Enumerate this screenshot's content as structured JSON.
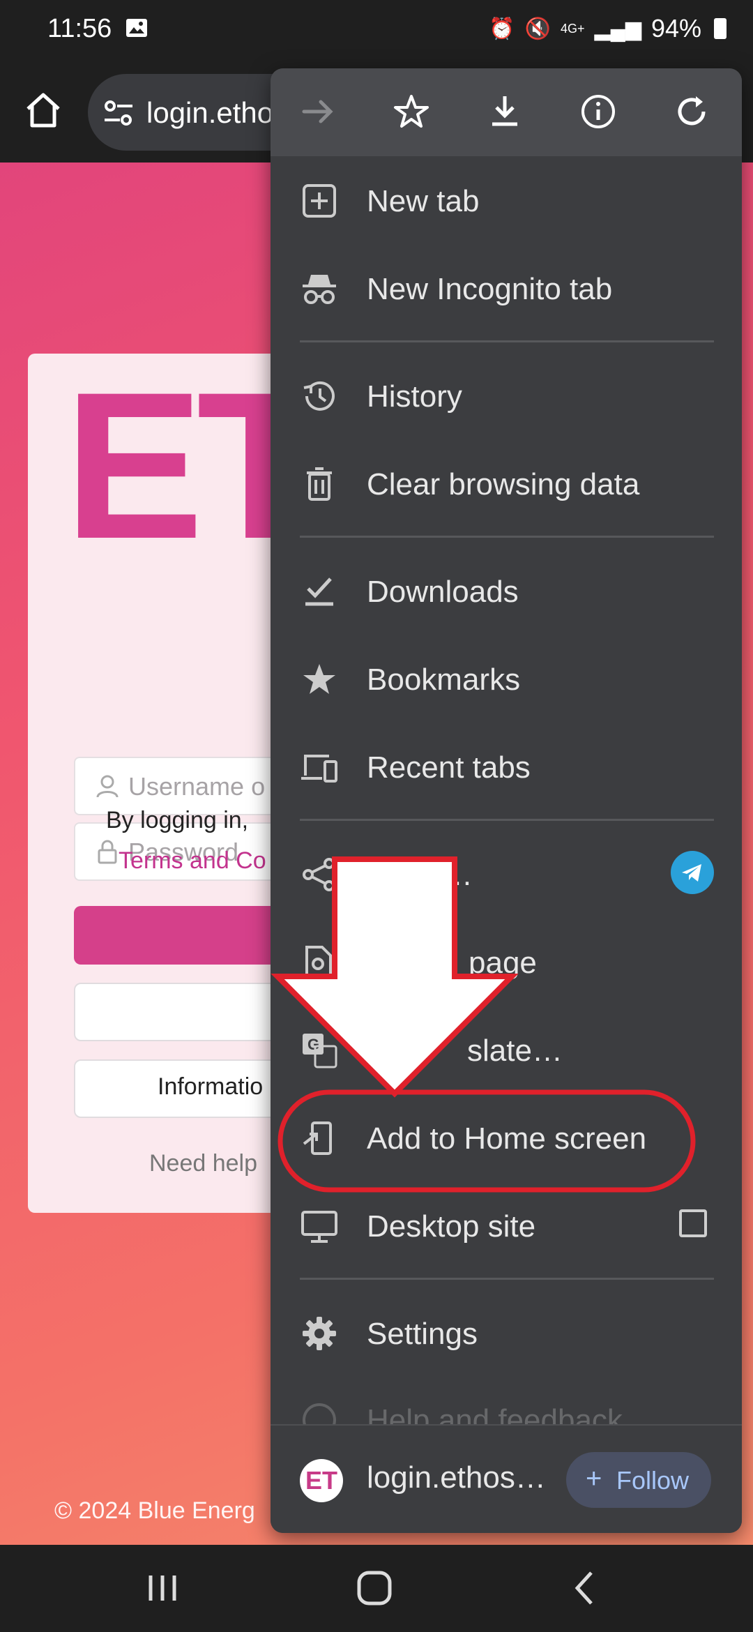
{
  "status_bar": {
    "time": "11:56",
    "network": "4G+",
    "battery": "94%"
  },
  "browser": {
    "url": "login.ethos"
  },
  "page": {
    "logo": "ET",
    "username_placeholder": "Username o",
    "password_placeholder": "Password",
    "consent_text": "By logging in,",
    "terms_link": "Terms and Co",
    "info_button": "Informatio",
    "need_help": "Need help",
    "copyright": "© 2024 Blue Energ"
  },
  "menu": {
    "top_icons": [
      "forward-arrow-icon",
      "star-icon",
      "download-icon",
      "info-icon",
      "refresh-icon"
    ],
    "items": [
      {
        "label": "New tab",
        "icon": "new-tab-icon"
      },
      {
        "label": "New Incognito tab",
        "icon": "incognito-icon"
      },
      {
        "label": "History",
        "icon": "history-icon"
      },
      {
        "label": "Clear browsing data",
        "icon": "trash-icon"
      },
      {
        "label": "Downloads",
        "icon": "downloads-check-icon"
      },
      {
        "label": "Bookmarks",
        "icon": "star-icon"
      },
      {
        "label": "Recent tabs",
        "icon": "devices-icon"
      },
      {
        "label": "…",
        "icon": "share-icon"
      },
      {
        "label": "page",
        "icon": "find-in-page-icon"
      },
      {
        "label": "slate…",
        "icon": "translate-icon"
      },
      {
        "label": "Add to Home screen",
        "icon": "add-to-home-icon"
      },
      {
        "label": "Desktop site",
        "icon": "desktop-icon"
      },
      {
        "label": "Settings",
        "icon": "gear-icon"
      },
      {
        "label": "Help and feedback",
        "icon": "help-icon"
      }
    ],
    "footer": {
      "favicon_text": "ET",
      "site": "login.ethos…",
      "follow": "Follow"
    }
  },
  "annotation_colors": {
    "highlight": "#e0212b",
    "arrow_fill": "#ffffff"
  },
  "colors": {
    "brand": "#d5408a",
    "menu_bg": "#3c3d40"
  }
}
